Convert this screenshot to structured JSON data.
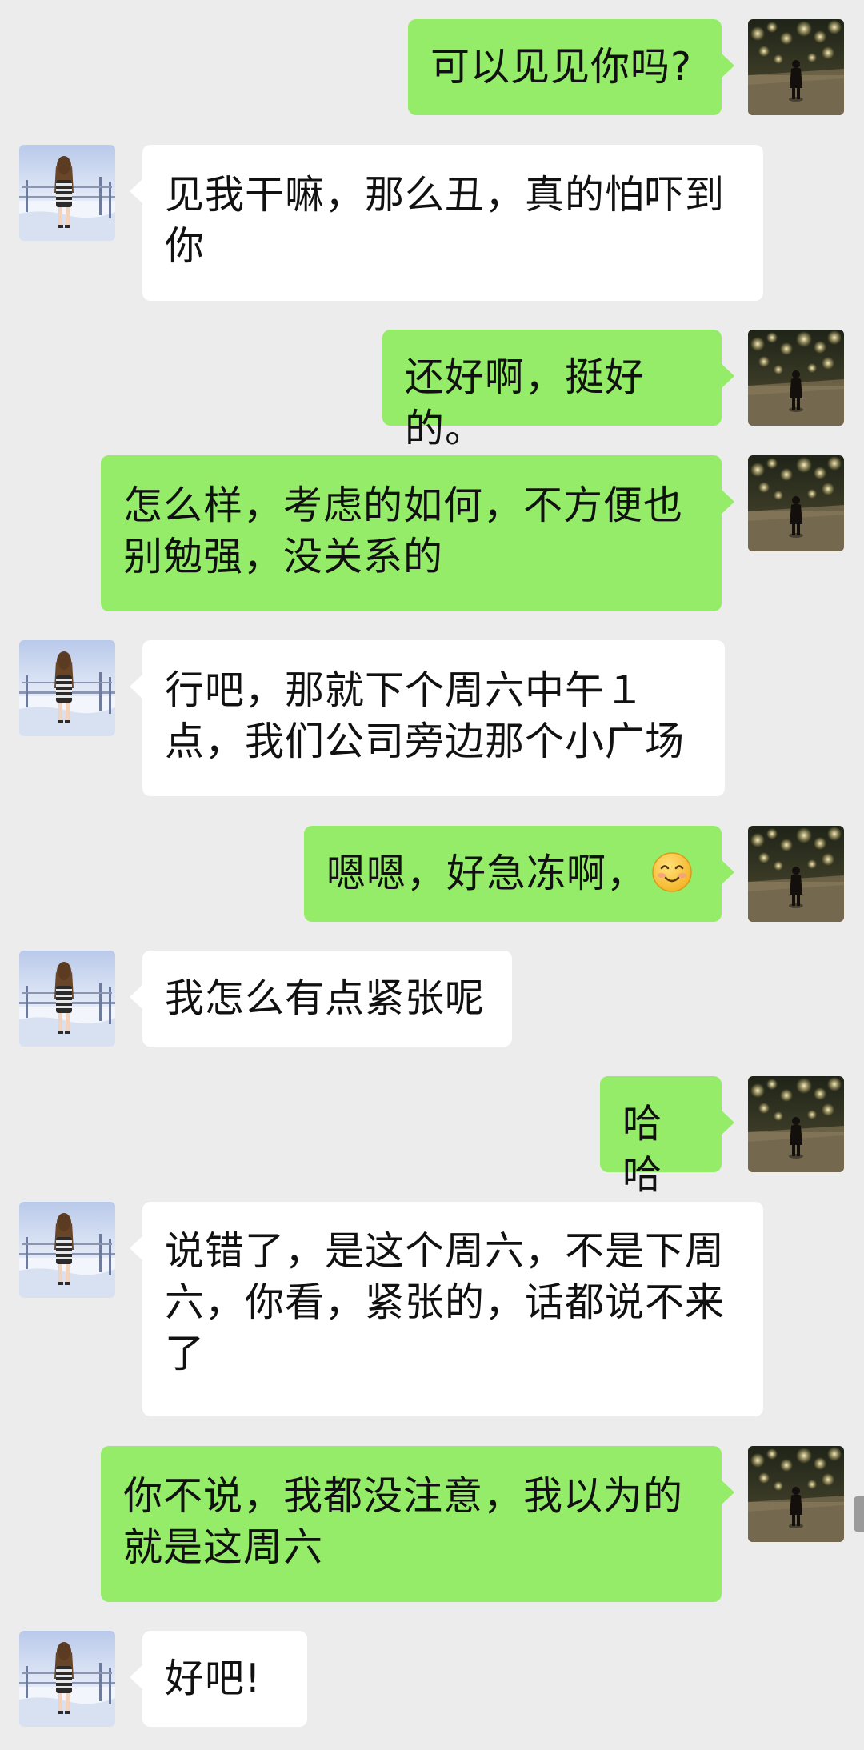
{
  "conversation": {
    "messages": [
      {
        "side": "sent",
        "text": "可以见见你吗?"
      },
      {
        "side": "received",
        "text": "见我干嘛，那么丑，真的怕吓到你"
      },
      {
        "side": "sent",
        "text": "还好啊，挺好的。"
      },
      {
        "side": "sent",
        "text": "怎么样，考虑的如何，不方便也别勉强，没关系的"
      },
      {
        "side": "received",
        "text": "行吧，那就下个周六中午１点，我们公司旁边那个小广场"
      },
      {
        "side": "sent",
        "text": "嗯嗯，好急冻啊，",
        "emoji": "smiling-face-emoji"
      },
      {
        "side": "received",
        "text": "我怎么有点紧张呢"
      },
      {
        "side": "sent",
        "text": "哈哈"
      },
      {
        "side": "received",
        "text": "说错了，是这个周六，不是下周六，你看，紧张的，话都说不来了"
      },
      {
        "side": "sent",
        "text": "你不说，我都没注意，我以为的就是这周六"
      },
      {
        "side": "received",
        "text": "好吧!"
      }
    ]
  },
  "colors": {
    "background": "#ececec",
    "sent_bubble": "#95ec69",
    "received_bubble": "#ffffff",
    "text": "#111111"
  }
}
